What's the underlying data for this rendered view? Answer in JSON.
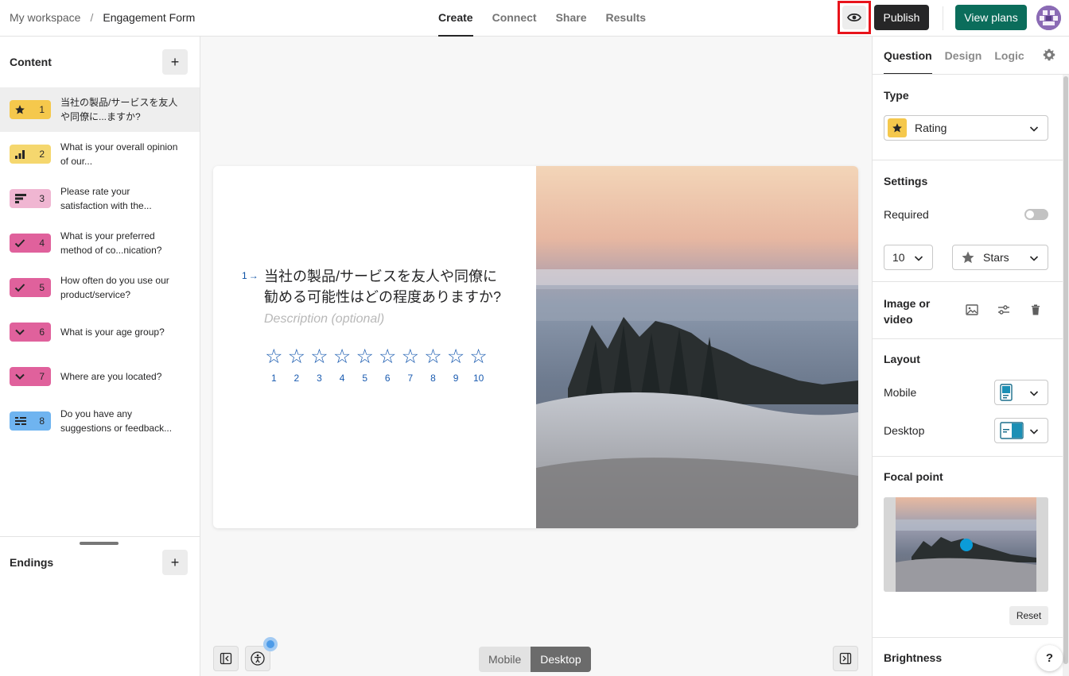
{
  "breadcrumb": {
    "workspace": "My workspace",
    "separator": "/",
    "form": "Engagement Form"
  },
  "main_tabs": [
    {
      "label": "Create",
      "active": true
    },
    {
      "label": "Connect",
      "active": false
    },
    {
      "label": "Share",
      "active": false
    },
    {
      "label": "Results",
      "active": false
    }
  ],
  "header": {
    "preview_icon": "eye-icon",
    "publish_label": "Publish",
    "plans_label": "View plans"
  },
  "content_panel": {
    "title": "Content",
    "add_icon": "+",
    "questions": [
      {
        "num": "1",
        "text": "当社の製品/サービスを友人や同僚に...ますか?",
        "icon": "star-icon",
        "color": "#f5c84c"
      },
      {
        "num": "2",
        "text": "What is your overall opinion of our...",
        "icon": "bars-icon",
        "color": "#f5d76e"
      },
      {
        "num": "3",
        "text": "Please rate your satisfaction with the...",
        "icon": "ranking-icon",
        "color": "#f0b6d2"
      },
      {
        "num": "4",
        "text": "What is your preferred method of co...nication?",
        "icon": "check-icon",
        "color": "#e0619c"
      },
      {
        "num": "5",
        "text": "How often do you use our product/service?",
        "icon": "check-icon",
        "color": "#e0619c"
      },
      {
        "num": "6",
        "text": "What is your age group?",
        "icon": "chevron-down-icon",
        "color": "#e0619c"
      },
      {
        "num": "7",
        "text": "Where are you located?",
        "icon": "chevron-down-icon",
        "color": "#e0619c"
      },
      {
        "num": "8",
        "text": "Do you have any suggestions or feedback...",
        "icon": "long-text-icon",
        "color": "#6fb4f0"
      }
    ],
    "endings_title": "Endings",
    "endings_add_icon": "+"
  },
  "question_card": {
    "number": "1",
    "arrow": "→",
    "title": "当社の製品/サービスを友人や同僚に勧める可能性はどの程度ありますか?",
    "description_placeholder": "Description (optional)",
    "rating_labels": [
      "1",
      "2",
      "3",
      "4",
      "5",
      "6",
      "7",
      "8",
      "9",
      "10"
    ],
    "star_glyph": "☆"
  },
  "canvas_footer": {
    "mobile_label": "Mobile",
    "desktop_label": "Desktop",
    "selected": "Desktop"
  },
  "right_panel": {
    "tabs": [
      {
        "label": "Question",
        "active": true
      },
      {
        "label": "Design",
        "active": false
      },
      {
        "label": "Logic",
        "active": false
      }
    ],
    "type_label": "Type",
    "type_value": "Rating",
    "settings_label": "Settings",
    "required_label": "Required",
    "required_on": false,
    "steps_value": "10",
    "shape_value": "Stars",
    "image_label": "Image or video",
    "layout_label": "Layout",
    "mobile_label": "Mobile",
    "desktop_label": "Desktop",
    "focal_label": "Focal point",
    "reset_label": "Reset",
    "brightness_label": "Brightness"
  },
  "help_label": "?"
}
